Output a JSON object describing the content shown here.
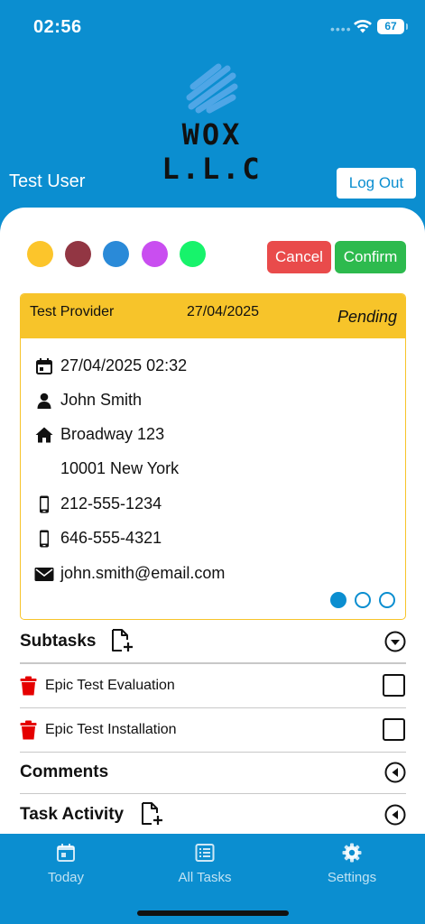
{
  "status_bar": {
    "time": "02:56",
    "battery": "67"
  },
  "logo": {
    "text": "WOX L.L.C"
  },
  "header": {
    "user_name": "Test User",
    "logout_label": "Log Out"
  },
  "color_options": [
    "#fcc52b",
    "#923643",
    "#2a8ad8",
    "#c94ef0",
    "#17f36b"
  ],
  "actions": {
    "cancel_label": "Cancel",
    "confirm_label": "Confirm"
  },
  "task": {
    "provider": "Test Provider",
    "date": "27/04/2025",
    "status": "Pending",
    "datetime": "27/04/2025 02:32",
    "customer_name": "John Smith",
    "address_line1": "Broadway 123",
    "address_line2": "10001 New York",
    "phone1": "212-555-1234",
    "phone2": "646-555-4321",
    "email": "john.smith@email.com"
  },
  "sections": {
    "subtasks_title": "Subtasks",
    "subtasks": [
      {
        "label": "Epic Test Evaluation"
      },
      {
        "label": "Epic Test Installation"
      }
    ],
    "comments_title": "Comments",
    "activity_title": "Task Activity"
  },
  "nav": [
    {
      "label": "Today",
      "icon": "calendar-icon"
    },
    {
      "label": "All Tasks",
      "icon": "list-icon"
    },
    {
      "label": "Settings",
      "icon": "gear-icon"
    }
  ],
  "theme": {
    "primary": "#0b8ed0",
    "card_accent": "#f7c42a",
    "danger": "#e94b4b",
    "success": "#2dba4e"
  }
}
